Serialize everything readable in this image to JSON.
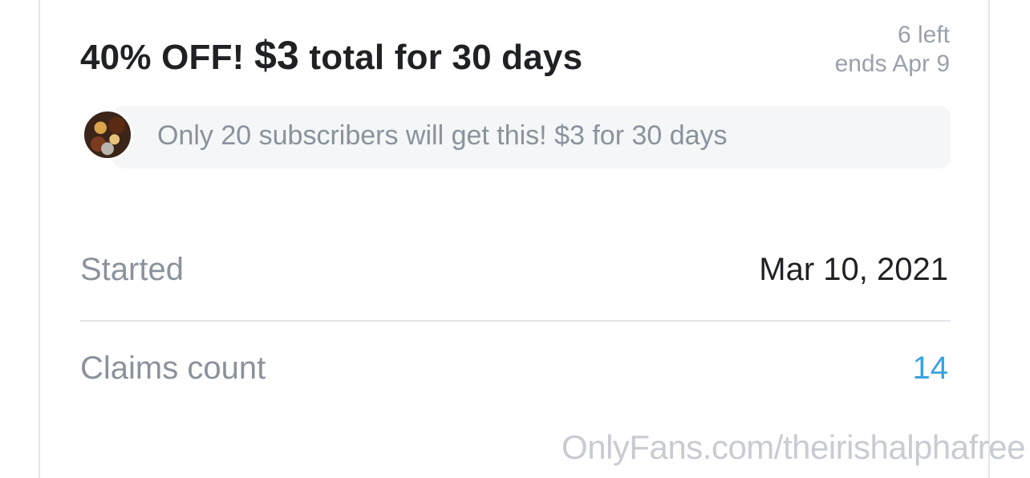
{
  "offer": {
    "prefix": "40% OFF!",
    "price": "$3",
    "suffix": "total for 30 days",
    "remaining": "6 left",
    "ends": "ends Apr 9"
  },
  "promo": {
    "message": "Only 20 subscribers will get this! $3 for 30 days"
  },
  "details": {
    "started_label": "Started",
    "started_value": "Mar 10, 2021",
    "claims_label": "Claims count",
    "claims_value": "14"
  },
  "watermark": "OnlyFans.com/theirishalphafree",
  "colors": {
    "accent": "#3aa2e0",
    "title_text": "#1f2124",
    "muted_text": "#8a929c",
    "promo_background": "#f5f6f7"
  }
}
